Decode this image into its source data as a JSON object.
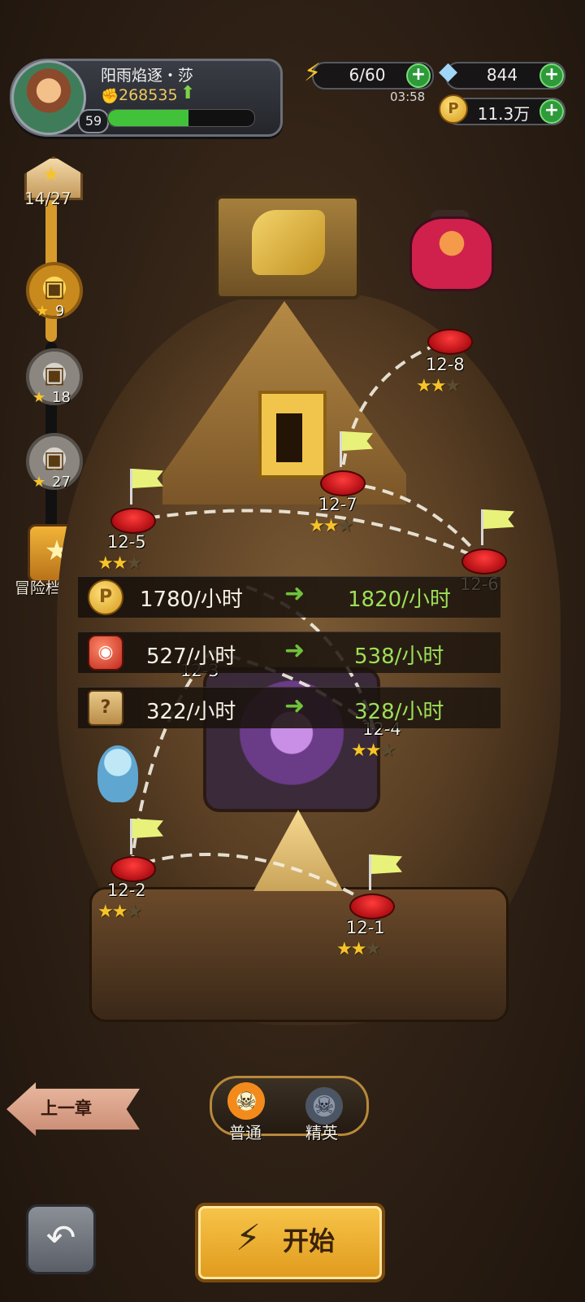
{
  "player": {
    "name": "阳雨焰逐・莎",
    "power": "268535",
    "level": "59",
    "xp_fraction": 0.55
  },
  "resources": {
    "energy": "6/60",
    "energy_timer": "03:58",
    "diamonds": "844",
    "gold": "11.3万"
  },
  "star_track": {
    "progress": "14/27",
    "chests": [
      {
        "stars": "9",
        "state": "unlocked"
      },
      {
        "stars": "18",
        "state": "locked"
      },
      {
        "stars": "27",
        "state": "locked"
      }
    ]
  },
  "archive": {
    "label": "冒险档案"
  },
  "stages": [
    {
      "label": "12-1",
      "stars": 2
    },
    {
      "label": "12-2",
      "stars": 2
    },
    {
      "label": "12-3",
      "stars": 2
    },
    {
      "label": "12-4",
      "stars": 2
    },
    {
      "label": "12-5",
      "stars": 2
    },
    {
      "label": "12-6",
      "stars": 2
    },
    {
      "label": "12-7",
      "stars": 2
    },
    {
      "label": "12-8",
      "stars": 2
    }
  ],
  "income": [
    {
      "icon": "coin-icon",
      "current": "1780/小时",
      "next": "1820/小时"
    },
    {
      "icon": "jar-icon",
      "current": "527/小时",
      "next": "538/小时"
    },
    {
      "icon": "scroll-icon",
      "current": "322/小时",
      "next": "328/小时"
    }
  ],
  "controls": {
    "prev_chapter": "上一章",
    "mode_normal": "普通",
    "mode_elite": "精英",
    "start": "开始"
  },
  "colors": {
    "accent_gold": "#f6c42a",
    "node_red": "#d4141b",
    "income_green": "#9de058"
  }
}
